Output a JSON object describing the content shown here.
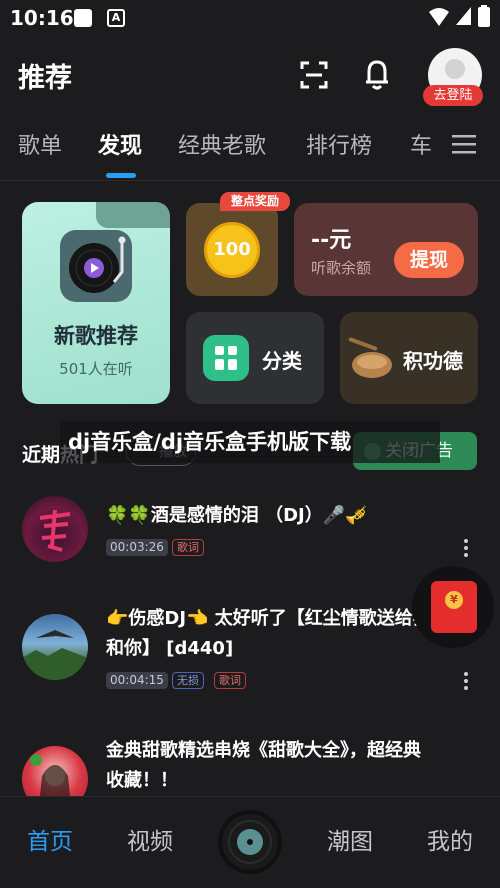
{
  "status_bar": {
    "time": "10:16",
    "app_icon_letter": "A"
  },
  "header": {
    "title": "推荐",
    "login_badge": "去登陆"
  },
  "tabs": [
    {
      "label": "歌单",
      "active": false
    },
    {
      "label": "发现",
      "active": true
    },
    {
      "label": "经典老歌",
      "active": false
    },
    {
      "label": "排行榜",
      "active": false
    },
    {
      "label": "车",
      "active": false
    }
  ],
  "cards": {
    "new_songs": {
      "title": "新歌推荐",
      "listeners": "501人在听"
    },
    "coin": {
      "value": "100",
      "badge": "整点奖励"
    },
    "balance": {
      "amount": "--元",
      "label": "听歌余额",
      "button": "提现"
    },
    "category": {
      "label": "分类"
    },
    "merit": {
      "label": "积功德"
    }
  },
  "recent": {
    "title": "近期热门",
    "play_all": "播放"
  },
  "ad": {
    "text": "dj音乐盒/dj音乐盒手机版下载",
    "close_label": "关闭广告"
  },
  "songs": [
    {
      "title": "🍀🍀酒是感情的泪 （DJ）🎤🎺",
      "duration": "00:03:26",
      "tags": [
        "歌词"
      ]
    },
    {
      "title": "👉伤感DJ👈 太好听了【红尘情歌送给我和你】 [d440]",
      "duration": "00:04:15",
      "tags": [
        "无损",
        "歌词"
      ]
    },
    {
      "title": "金典甜歌精选串烧《甜歌大全》，超经典收藏！！",
      "duration": "",
      "tags": []
    }
  ],
  "redpacket": {
    "symbol": "¥"
  },
  "bottom_nav": [
    {
      "label": "首页",
      "active": true
    },
    {
      "label": "视频",
      "active": false
    },
    {
      "label": "潮图",
      "active": false
    },
    {
      "label": "我的",
      "active": false
    }
  ],
  "colors": {
    "accent": "#2a9df4",
    "background": "#1c1c1e",
    "red": "#e53935"
  }
}
